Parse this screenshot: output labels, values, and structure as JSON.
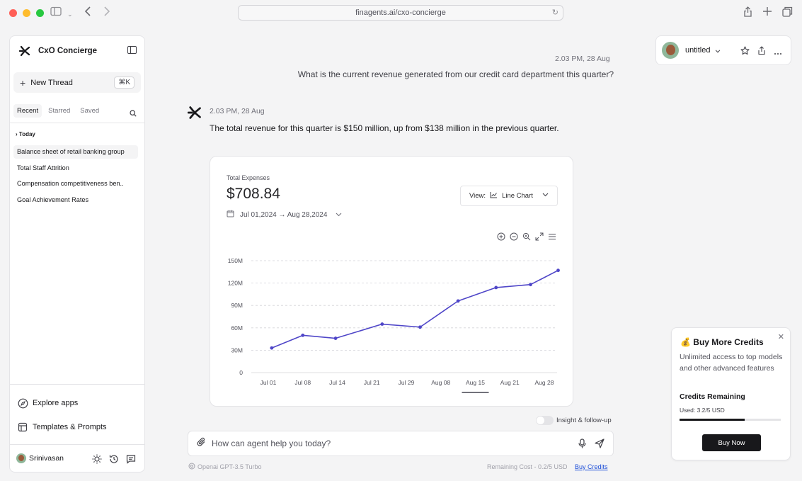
{
  "browser": {
    "url": "finagents.ai/cxo-concierge",
    "traffic_lights": [
      "#ff5f57",
      "#febc2e",
      "#28c840"
    ]
  },
  "sidebar": {
    "title": "CxO Concierge",
    "new_thread_label": "New Thread",
    "new_thread_shortcut": "⌘K",
    "tabs": [
      "Recent",
      "Starred",
      "Saved"
    ],
    "section_title": "Today",
    "threads": [
      "Balance sheet of retail banking group",
      "Total Staff Attrition",
      "Compensation competitiveness ben..",
      "Goal Achievement Rates"
    ],
    "explore_label": "Explore apps",
    "templates_label": "Templates & Prompts",
    "user_name": "Srinivasan"
  },
  "chat": {
    "question_time": "2.03 PM, 28 Aug",
    "question": "What is the current revenue generated from our credit card department this quarter?",
    "answer_time": "2.03 PM, 28 Aug",
    "answer": "The total revenue for this quarter is $150 million, up from $138 million in the previous quarter."
  },
  "card": {
    "label": "Total Expenses",
    "value": "$708.84",
    "date_range": "Jul 01,2024 → Aug 28,2024",
    "view_label": "View:",
    "view_value": "Line Chart"
  },
  "chart_data": {
    "type": "line",
    "categories": [
      "Jul 01",
      "Jul 08",
      "Jul 14",
      "Jul 21",
      "Jul 29",
      "Aug 08",
      "Aug 15",
      "Aug 21",
      "Aug 28"
    ],
    "x": [
      0,
      1,
      2,
      3,
      4,
      5,
      6,
      7,
      8
    ],
    "y_ticks": [
      "0",
      "30M",
      "60M",
      "90M",
      "120M",
      "150M"
    ],
    "y_tick_values": [
      0,
      30,
      60,
      90,
      120,
      150
    ],
    "points": [
      {
        "x": 0.1,
        "y": 33
      },
      {
        "x": 1,
        "y": 50
      },
      {
        "x": 1.95,
        "y": 46
      },
      {
        "x": 3.3,
        "y": 65
      },
      {
        "x": 4.4,
        "y": 61
      },
      {
        "x": 5.5,
        "y": 96
      },
      {
        "x": 6.6,
        "y": 114
      },
      {
        "x": 7.6,
        "y": 118
      },
      {
        "x": 8.4,
        "y": 137
      }
    ],
    "ylim": [
      0,
      150
    ],
    "grid": true,
    "line_color": "#4f46c8",
    "highlighted_category": "Aug 15"
  },
  "input": {
    "insight_label": "Insight & follow-up",
    "placeholder": "How can agent help you today?",
    "model": "Openai GPT-3.5 Turbo",
    "cost": "Remaining Cost - 0.2/5 USD",
    "buy_link": "Buy Credits"
  },
  "top_bar": {
    "doc_name": "untitled"
  },
  "credits": {
    "title": "💰 Buy More Credits",
    "description": "Unlimited access to top models and other advanced features",
    "remaining_label": "Credits Remaining",
    "used_label": "Used: 3.2/5 USD",
    "used_fraction": 0.64,
    "button_label": "Buy Now"
  },
  "colors": {
    "accent": "#4f46c8",
    "dark": "#18181b"
  }
}
